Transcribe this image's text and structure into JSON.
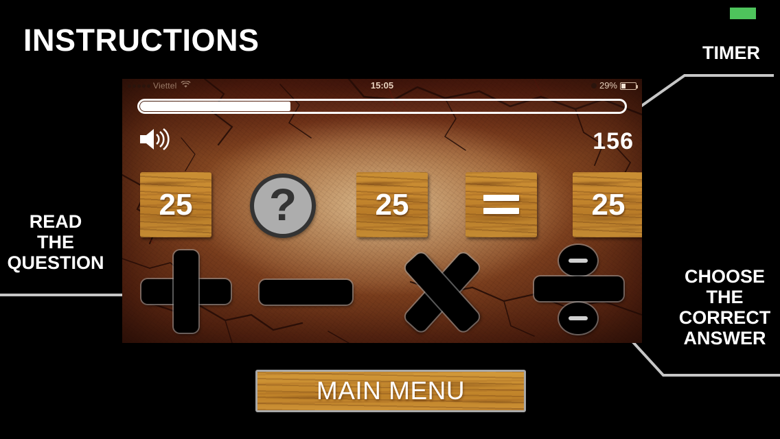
{
  "page": {
    "title": "INSTRUCTIONS",
    "background_color": "#000000"
  },
  "status_chip": {
    "name": "recording-indicator",
    "color": "#4ec45c"
  },
  "annotations": [
    {
      "id": "timer",
      "label": "TIMER"
    },
    {
      "id": "read-question",
      "label": "READ\nTHE\nQUESTION"
    },
    {
      "id": "choose-answer",
      "label": "CHOOSE\nTHE\nCORRECT\nANSWER"
    }
  ],
  "annotation_text": {
    "timer": "TIMER",
    "read_question": "READ\nTHE\nQUESTION",
    "choose_answer": "CHOOSE\nTHE\nCORRECT\nANSWER"
  },
  "game_screen": {
    "status_bar": {
      "signal_dots": 5,
      "carrier": "Viettel",
      "wifi_icon": "wifi-icon",
      "time": "15:05",
      "battery_percent": "29%",
      "battery_level": 29
    },
    "timer": {
      "icon": "timer-progress-bar",
      "fill_percent": 31
    },
    "sound_button": {
      "icon": "speaker-on-icon",
      "state": "on"
    },
    "score": "156",
    "question_row": [
      {
        "type": "number",
        "value": "25",
        "name": "operand-tile-1"
      },
      {
        "type": "unknown",
        "value": "?",
        "name": "unknown-operator-tile"
      },
      {
        "type": "number",
        "value": "25",
        "name": "operand-tile-2"
      },
      {
        "type": "equals",
        "value": "=",
        "name": "equals-tile"
      },
      {
        "type": "number",
        "value": "25",
        "name": "result-tile"
      }
    ],
    "answer_buttons": [
      {
        "op": "plus",
        "symbol": "+",
        "name": "answer-plus-button"
      },
      {
        "op": "minus",
        "symbol": "−",
        "name": "answer-minus-button"
      },
      {
        "op": "times",
        "symbol": "×",
        "name": "answer-multiply-button"
      },
      {
        "op": "divide",
        "symbol": "÷",
        "name": "answer-divide-button"
      }
    ]
  },
  "main_menu_button": {
    "label": "MAIN MENU"
  }
}
